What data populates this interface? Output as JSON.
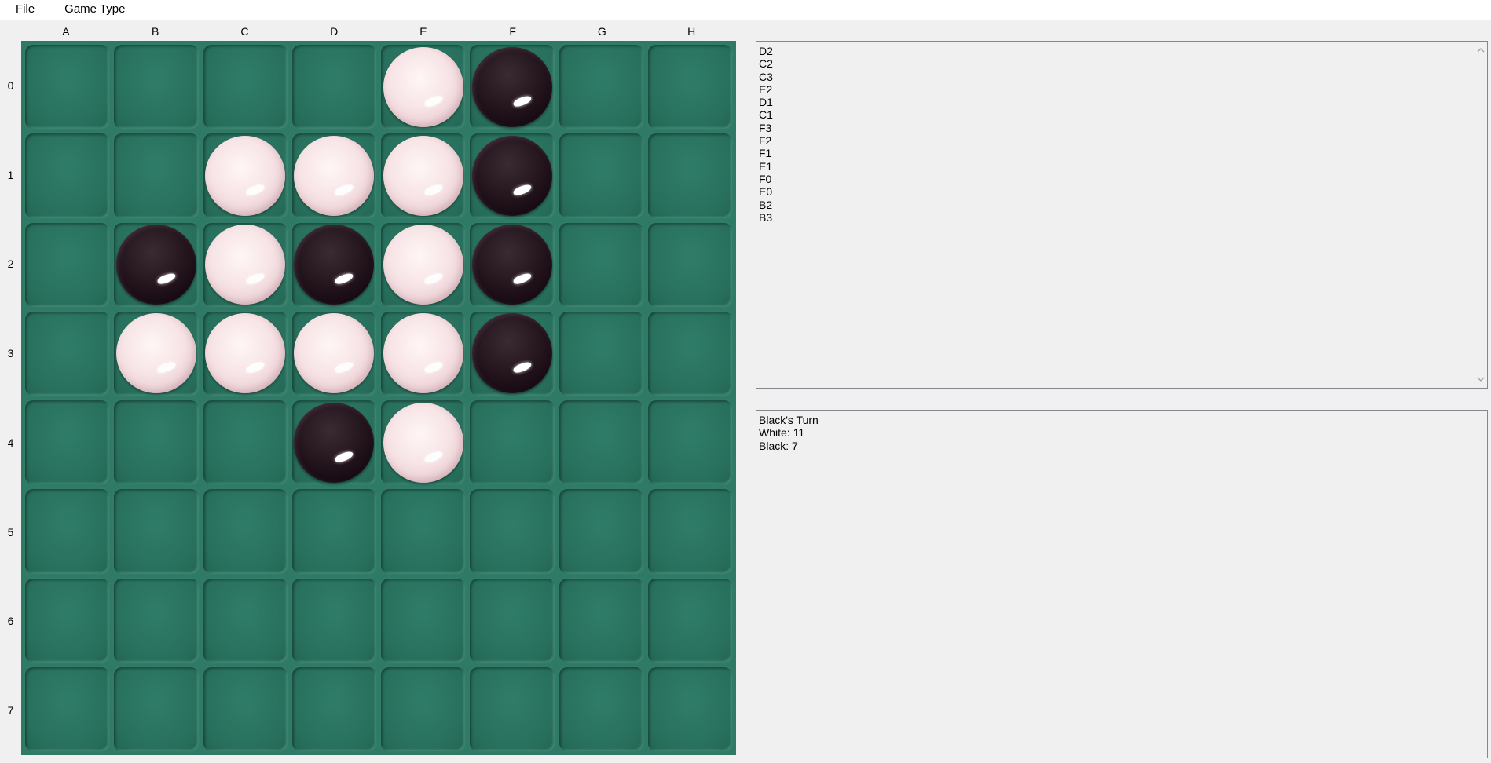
{
  "menu": {
    "file_label": "File",
    "game_type_label": "Game Type"
  },
  "board": {
    "columns": [
      "A",
      "B",
      "C",
      "D",
      "E",
      "F",
      "G",
      "H"
    ],
    "rows": [
      "0",
      "1",
      "2",
      "3",
      "4",
      "5",
      "6",
      "7"
    ],
    "cells": [
      [
        "",
        "",
        "",
        "",
        "W",
        "B",
        "",
        ""
      ],
      [
        "",
        "",
        "W",
        "W",
        "W",
        "B",
        "",
        ""
      ],
      [
        "",
        "B",
        "W",
        "B",
        "W",
        "B",
        "",
        ""
      ],
      [
        "",
        "W",
        "W",
        "W",
        "W",
        "B",
        "",
        ""
      ],
      [
        "",
        "",
        "",
        "B",
        "W",
        "",
        "",
        ""
      ],
      [
        "",
        "",
        "",
        "",
        "",
        "",
        "",
        ""
      ],
      [
        "",
        "",
        "",
        "",
        "",
        "",
        "",
        ""
      ],
      [
        "",
        "",
        "",
        "",
        "",
        "",
        "",
        ""
      ]
    ],
    "colors": {
      "felt": "#2e7a66",
      "white_piece": "#f7e4e6",
      "black_piece": "#1a0c14"
    }
  },
  "moves": [
    "D2",
    "C2",
    "C3",
    "E2",
    "D1",
    "C1",
    "F3",
    "F2",
    "F1",
    "E1",
    "F0",
    "E0",
    "B2",
    "B3"
  ],
  "status": {
    "turn": "Black's Turn",
    "white_score": "White: 11",
    "black_score": "Black: 7"
  },
  "icons": {
    "scroll_up": "chevron-up-icon",
    "scroll_down": "chevron-down-icon"
  }
}
